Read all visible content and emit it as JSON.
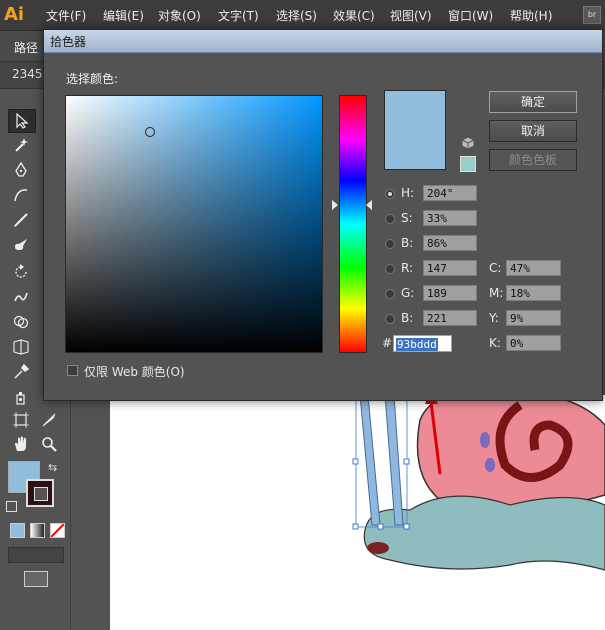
{
  "app": {
    "logo": "Ai",
    "menu": [
      "文件(F)",
      "编辑(E)",
      "对象(O)",
      "文字(T)",
      "选择(S)",
      "效果(C)",
      "视图(V)",
      "窗口(W)",
      "帮助(H)"
    ],
    "corner_badge": "br"
  },
  "controlbar": {
    "label": "路径"
  },
  "tabrow": {
    "label": "2345"
  },
  "dialog": {
    "title": "拾色器",
    "select_label": "选择颜色:",
    "buttons": {
      "ok": "确定",
      "cancel": "取消",
      "swatches": "颜色色板"
    },
    "current_color": "#93bddd",
    "web_safe_color": "#99cccc",
    "hsb": {
      "h_label": "H:",
      "h_value": "204°",
      "s_label": "S:",
      "s_value": "33%",
      "b_label": "B:",
      "b_value": "86%"
    },
    "rgb": {
      "r_label": "R:",
      "r_value": "147",
      "g_label": "G:",
      "g_value": "189",
      "b_label": "B:",
      "b_value": "221"
    },
    "cmyk": {
      "c_label": "C:",
      "c_value": "47%",
      "m_label": "M:",
      "m_value": "18%",
      "y_label": "Y:",
      "y_value": "9%",
      "k_label": "K:",
      "k_value": "0%"
    },
    "hex_label": "#",
    "hex_value": "93bddd",
    "web_only_label": "仅限 Web 颜色(O)"
  },
  "swatches": {
    "fill": "#93bddd",
    "stroke": "#2b1111"
  },
  "icons": [
    "selection-icon",
    "magic-wand-icon",
    "pen-icon",
    "curvature-icon",
    "brush-icon",
    "blob-brush-icon",
    "rotate-icon",
    "warp-icon",
    "shape-builder-icon",
    "perspective-icon",
    "eyedropper-icon",
    "symbol-sprayer-icon",
    "artboard-icon",
    "slice-icon",
    "hand-icon",
    "zoom-icon"
  ]
}
